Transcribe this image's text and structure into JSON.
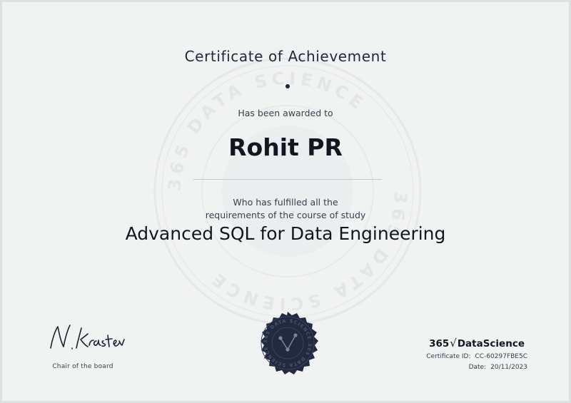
{
  "certificate": {
    "title": "Certificate of Achievement",
    "awarded_text": "Has been awarded to",
    "recipient_name": "Rohit PR",
    "fulfilled_line1": "Who has fulfilled all the",
    "fulfilled_line2": "requirements of the course of study",
    "course_name": "Advanced SQL for Data Engineering"
  },
  "signature": {
    "text": "N.Krastev",
    "caption": "Chair of the board"
  },
  "seal": {
    "ring_text": "365 DATA SCIENCE"
  },
  "brand": {
    "prefix": "365",
    "radical": "√",
    "suffix": "DataScience"
  },
  "meta": {
    "id_label": "Certificate ID:",
    "id_value": "CC-60297FBE5C",
    "date_label": "Date:",
    "date_value": "20/11/2023"
  },
  "colors": {
    "background": "#f1f2f2",
    "ink": "#1d2233",
    "stamp": "#222a3f"
  }
}
